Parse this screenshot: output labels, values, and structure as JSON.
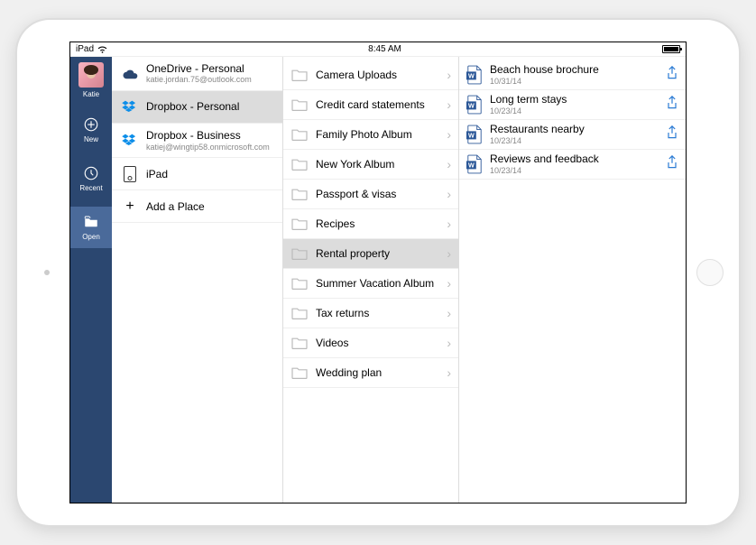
{
  "status": {
    "device": "iPad",
    "time": "8:45 AM"
  },
  "sidebar": {
    "user": "Katie",
    "nav": [
      {
        "label": "New"
      },
      {
        "label": "Recent"
      },
      {
        "label": "Open"
      }
    ]
  },
  "places": [
    {
      "title": "OneDrive - Personal",
      "sub": "katie.jordan.75@outlook.com",
      "icon": "onedrive",
      "selected": false
    },
    {
      "title": "Dropbox - Personal",
      "sub": "",
      "icon": "dropbox",
      "selected": true
    },
    {
      "title": "Dropbox - Business",
      "sub": "katiej@wingtip58.onmicrosoft.com",
      "icon": "dropbox",
      "selected": false
    },
    {
      "title": "iPad",
      "sub": "",
      "icon": "ipad",
      "selected": false
    },
    {
      "title": "Add a Place",
      "sub": "",
      "icon": "plus",
      "selected": false
    }
  ],
  "folders": [
    {
      "title": "Camera Uploads",
      "selected": false
    },
    {
      "title": "Credit card statements",
      "selected": false
    },
    {
      "title": "Family Photo Album",
      "selected": false
    },
    {
      "title": "New York Album",
      "selected": false
    },
    {
      "title": "Passport & visas",
      "selected": false
    },
    {
      "title": "Recipes",
      "selected": false
    },
    {
      "title": "Rental property",
      "selected": true
    },
    {
      "title": "Summer Vacation Album",
      "selected": false
    },
    {
      "title": "Tax returns",
      "selected": false
    },
    {
      "title": "Videos",
      "selected": false
    },
    {
      "title": "Wedding plan",
      "selected": false
    }
  ],
  "files": [
    {
      "title": "Beach house brochure",
      "date": "10/31/14"
    },
    {
      "title": "Long term stays",
      "date": "10/23/14"
    },
    {
      "title": "Restaurants nearby",
      "date": "10/23/14"
    },
    {
      "title": "Reviews and feedback",
      "date": "10/23/14"
    }
  ]
}
